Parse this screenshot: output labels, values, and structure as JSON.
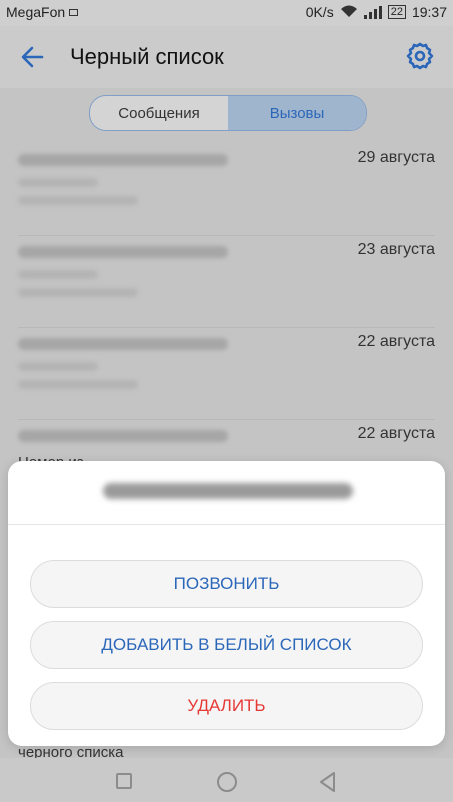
{
  "status": {
    "carrier": "MegaFon",
    "speed": "0K/s",
    "battery": "22",
    "time": "19:37"
  },
  "appbar": {
    "title": "Черный список"
  },
  "tabs": [
    {
      "label": "Сообщения",
      "active": false
    },
    {
      "label": "Вызовы",
      "active": true
    }
  ],
  "list": {
    "items": [
      {
        "date": "29 августа"
      },
      {
        "date": "23 августа"
      },
      {
        "date": "22 августа"
      },
      {
        "date": "22 августа",
        "line2": "Номер из"
      }
    ],
    "bottom_text": "черного списка"
  },
  "sheet": {
    "buttons": [
      {
        "label": "ПОЗВОНИТЬ"
      },
      {
        "label": "ДОБАВИТЬ В БЕЛЫЙ СПИСОК"
      },
      {
        "label": "УДАЛИТЬ"
      }
    ]
  },
  "colors": {
    "accent": "#2b67b9",
    "danger": "#e53935"
  },
  "icons": {
    "back": "back-arrow-icon",
    "settings": "gear-icon",
    "nav_recent": "square-icon",
    "nav_home": "circle-icon",
    "nav_back": "triangle-icon"
  }
}
